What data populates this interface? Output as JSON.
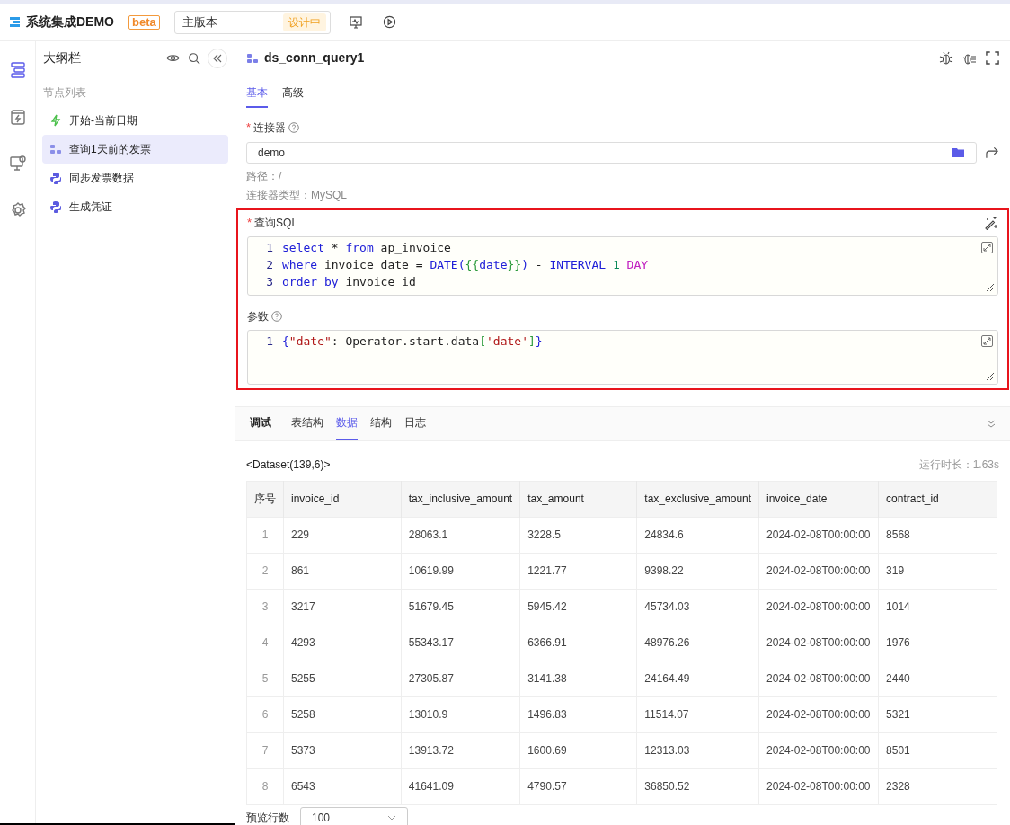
{
  "app": {
    "title": "系统集成DEMO",
    "badge": "beta",
    "version": "主版本",
    "version_status": "设计中"
  },
  "rail": [
    {
      "kind": "outline",
      "selected": true
    },
    {
      "kind": "event",
      "selected": false
    },
    {
      "kind": "monitor",
      "selected": false
    },
    {
      "kind": "settings",
      "selected": false
    }
  ],
  "outline": {
    "title": "大纲栏",
    "section": "节点列表",
    "items": [
      {
        "label": "开始-当前日期",
        "kind": "start",
        "selected": false
      },
      {
        "label": "查询1天前的发票",
        "kind": "query",
        "selected": true
      },
      {
        "label": "同步发票数据",
        "kind": "python",
        "selected": false
      },
      {
        "label": "生成凭证",
        "kind": "python",
        "selected": false
      }
    ]
  },
  "node": {
    "title": "ds_conn_query1",
    "tabs": [
      {
        "label": "基本",
        "selected": true
      },
      {
        "label": "高级",
        "selected": false
      }
    ],
    "connector": {
      "label": "连接器",
      "required": true,
      "value": "demo",
      "path": "路径：/",
      "type": "连接器类型：MySQL"
    },
    "sql": {
      "label": "查询SQL",
      "required": true,
      "lines": [
        {
          "number": "1",
          "tokens": [
            {
              "kind": "kw",
              "text": "select"
            },
            {
              "kind": "plain",
              "text": " * "
            },
            {
              "kind": "kw",
              "text": "from"
            },
            {
              "kind": "plain",
              "text": " ap_invoice"
            }
          ]
        },
        {
          "number": "2",
          "tokens": [
            {
              "kind": "kw",
              "text": "where"
            },
            {
              "kind": "plain",
              "text": " invoice_date = "
            },
            {
              "kind": "kw",
              "text": "DATE("
            },
            {
              "kind": "brace",
              "text": "{{"
            },
            {
              "kind": "kw",
              "text": "date"
            },
            {
              "kind": "brace",
              "text": "}}"
            },
            {
              "kind": "kw",
              "text": ")"
            },
            {
              "kind": "plain",
              "text": " - "
            },
            {
              "kind": "kw",
              "text": "INTERVAL "
            },
            {
              "kind": "num",
              "text": "1 "
            },
            {
              "kind": "type",
              "text": "DAY"
            }
          ]
        },
        {
          "number": "3",
          "tokens": [
            {
              "kind": "kw",
              "text": "order by"
            },
            {
              "kind": "plain",
              "text": " invoice_id"
            }
          ]
        }
      ]
    },
    "params": {
      "label": "参数",
      "required": false,
      "lines": [
        {
          "number": "1",
          "tokens": [
            {
              "kind": "kw",
              "text": "{"
            },
            {
              "kind": "str",
              "text": "\"date\""
            },
            {
              "kind": "plain",
              "text": ": Operator.start.data"
            },
            {
              "kind": "brace",
              "text": "["
            },
            {
              "kind": "str",
              "text": "'date'"
            },
            {
              "kind": "brace",
              "text": "]"
            },
            {
              "kind": "kw",
              "text": "}"
            }
          ]
        }
      ]
    }
  },
  "debug": {
    "title": "调试",
    "tabs": [
      {
        "label": "表结构",
        "selected": false
      },
      {
        "label": "数据",
        "selected": true
      },
      {
        "label": "结构",
        "selected": false
      },
      {
        "label": "日志",
        "selected": false
      }
    ],
    "dataset": "<Dataset(139,6)>",
    "runtime": "运行时长：1.63s",
    "table": {
      "columns": [
        "序号",
        "invoice_id",
        "tax_inclusive_amount",
        "tax_amount",
        "tax_exclusive_amount",
        "invoice_date",
        "contract_id"
      ],
      "rows": [
        [
          "1",
          "229",
          "28063.1",
          "3228.5",
          "24834.6",
          "2024-02-08T00:00:00",
          "8568"
        ],
        [
          "2",
          "861",
          "10619.99",
          "1221.77",
          "9398.22",
          "2024-02-08T00:00:00",
          "319"
        ],
        [
          "3",
          "3217",
          "51679.45",
          "5945.42",
          "45734.03",
          "2024-02-08T00:00:00",
          "1014"
        ],
        [
          "4",
          "4293",
          "55343.17",
          "6366.91",
          "48976.26",
          "2024-02-08T00:00:00",
          "1976"
        ],
        [
          "5",
          "5255",
          "27305.87",
          "3141.38",
          "24164.49",
          "2024-02-08T00:00:00",
          "2440"
        ],
        [
          "6",
          "5258",
          "13010.9",
          "1496.83",
          "11514.07",
          "2024-02-08T00:00:00",
          "5321"
        ],
        [
          "7",
          "5373",
          "13913.72",
          "1600.69",
          "12313.03",
          "2024-02-08T00:00:00",
          "8501"
        ],
        [
          "8",
          "6543",
          "41641.09",
          "4790.57",
          "36850.52",
          "2024-02-08T00:00:00",
          "2328"
        ]
      ]
    },
    "preview_label": "预览行数",
    "preview_value": "100"
  }
}
